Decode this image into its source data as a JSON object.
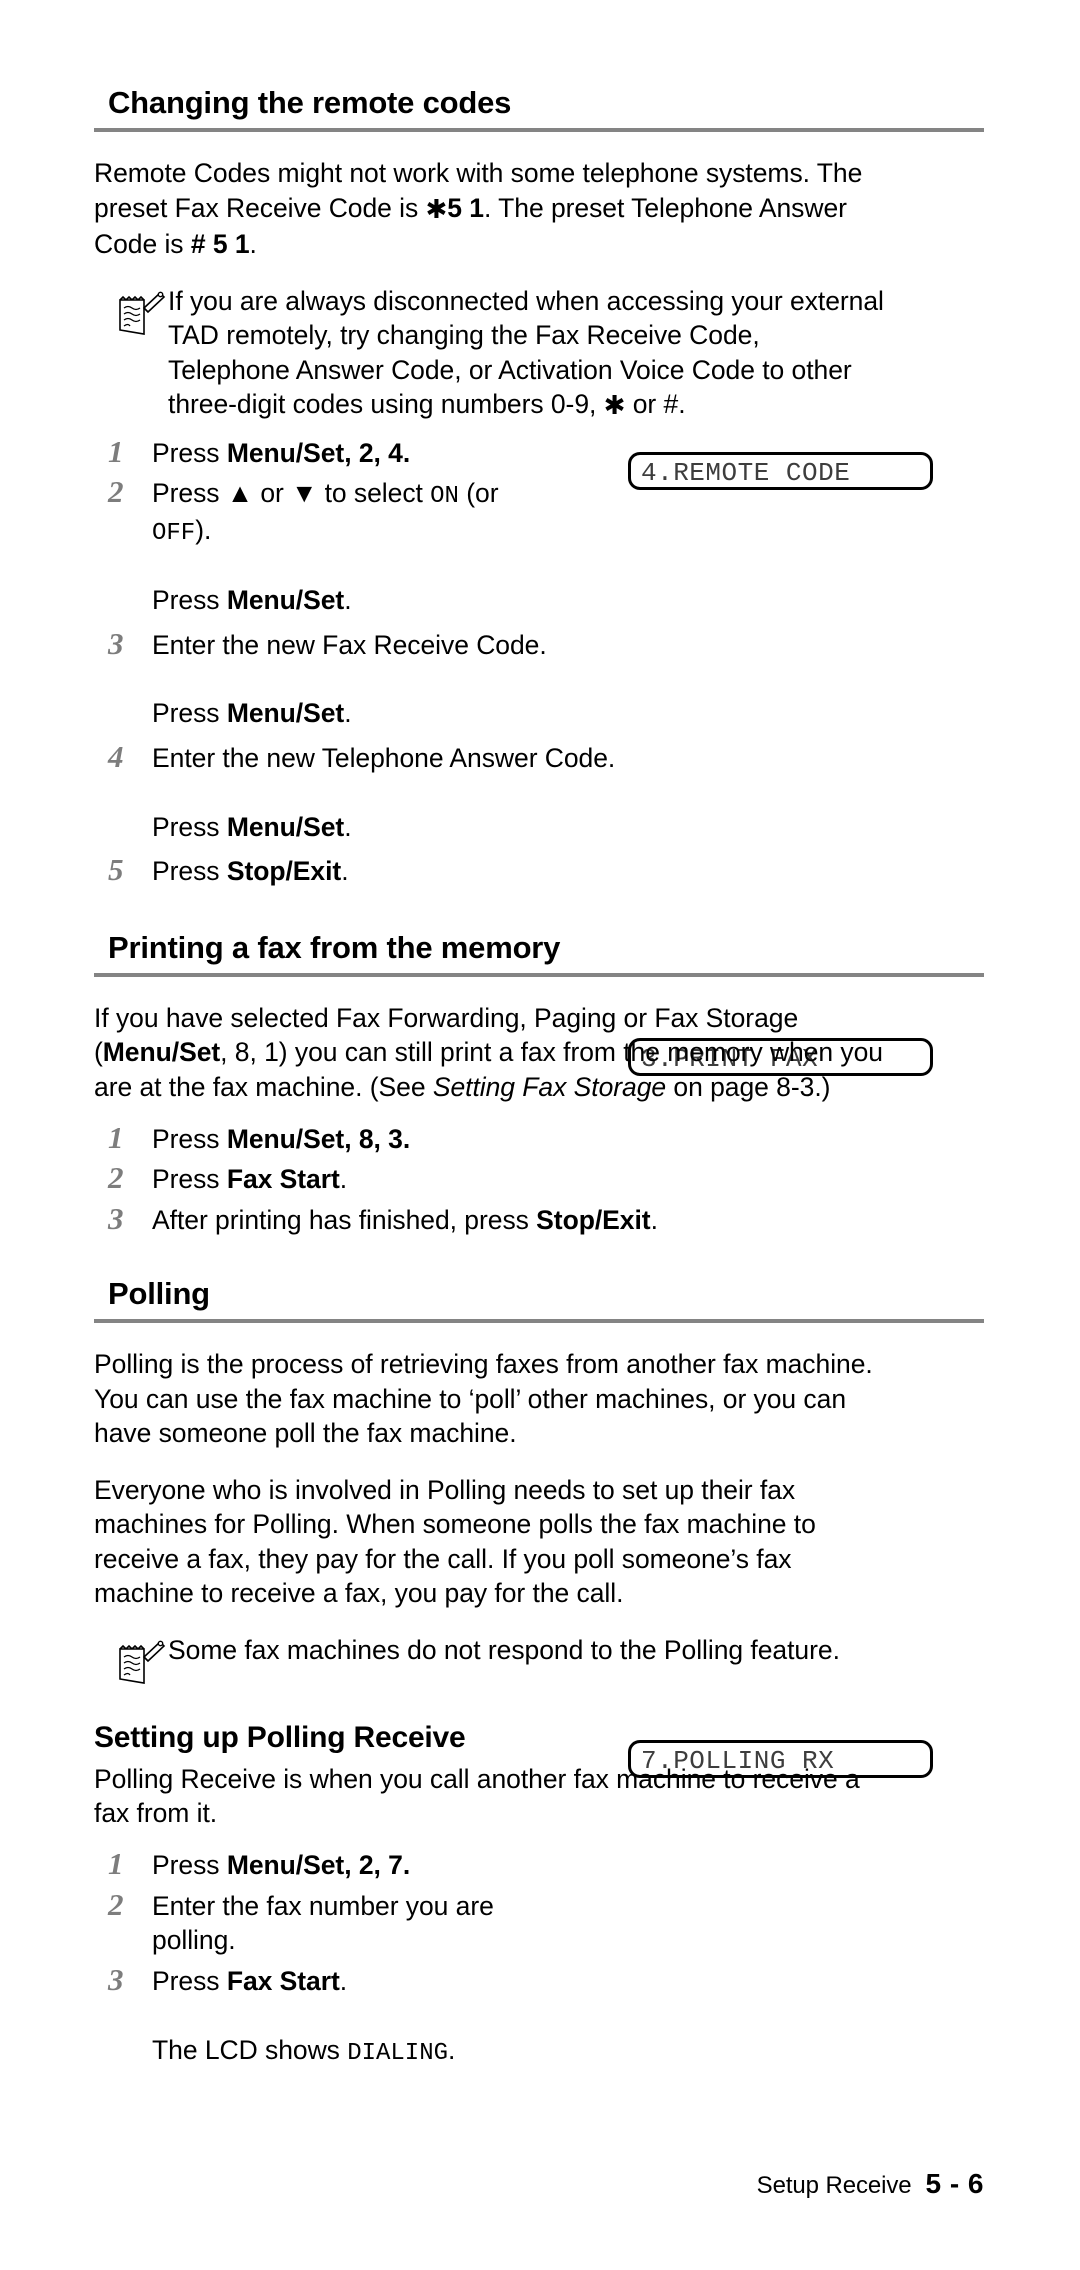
{
  "page": {
    "footer_label": "Setup Receive",
    "footer_page": "5 - 6"
  },
  "sections": {
    "remote_codes": {
      "heading": "Changing the remote codes",
      "intro_line1": "Remote Codes might not work with some telephone systems. The",
      "intro_line2_a": "preset Fax Receive Code is ",
      "intro_line2_ast": "✱",
      "intro_line2_code": "5 1",
      "intro_line2_b": ". The preset Telephone Answer",
      "intro_line3_a": "Code is ",
      "intro_line3_hash": "# 5 1",
      "intro_line3_b": ".",
      "note_line1": "If you are always disconnected when accessing your external",
      "note_line2": "TAD remotely, try changing the Fax Receive Code,",
      "note_line3": "Telephone Answer Code, or Activation Voice Code to other",
      "note_line4_a": "three-digit codes using numbers 0-9, ",
      "note_line4_ast": "✱",
      "note_line4_b": " or ",
      "note_line4_hash": "#",
      "note_line4_c": ".",
      "note_icon": "notepad-pencil-icon",
      "steps": [
        {
          "num": "1",
          "text_pre": "Press ",
          "text_bold": "Menu/Set",
          "text_post": ", 2, 4."
        },
        {
          "num": "2",
          "text_pre": "Press ",
          "up_arrow": "▲",
          "mid": " or ",
          "down_arrow": "▼",
          "mid2": " to select ",
          "mono_on": "ON",
          "mid3": " (or",
          "line2_mono_off": "OFF",
          "line2_post": ").",
          "line3_pre": "Press ",
          "line3_bold": "Menu/Set",
          "line3_post": "."
        },
        {
          "num": "3",
          "text": "Enter the new Fax Receive Code.",
          "line2_pre": "Press ",
          "line2_bold": "Menu/Set",
          "line2_post": "."
        },
        {
          "num": "4",
          "text": "Enter the new Telephone Answer Code.",
          "line2_pre": "Press ",
          "line2_bold": "Menu/Set",
          "line2_post": "."
        },
        {
          "num": "5",
          "text_pre": "Press ",
          "text_bold": "Stop/Exit",
          "text_post": "."
        }
      ],
      "lcd": "4.REMOTE CODE"
    },
    "print_fax": {
      "heading": "Printing a fax from the memory",
      "intro_line1": "If you have selected Fax Forwarding, Paging or Fax Storage",
      "intro_line2_open": "(",
      "intro_line2_bold": "Menu/Set",
      "intro_line2_rest": ", 8, 1) you can still print a fax from the memory when you",
      "intro_line3_a": "are at the fax machine. (See ",
      "intro_line3_italic": "Setting Fax Storage",
      "intro_line3_b": " on page 8-3.)",
      "steps": [
        {
          "num": "1",
          "text_pre": "Press ",
          "text_bold": "Menu/Set",
          "text_post": ", 8, 3."
        },
        {
          "num": "2",
          "text_pre": "Press ",
          "text_bold": "Fax Start",
          "text_post": "."
        },
        {
          "num": "3",
          "text_pre": "After printing has finished, press ",
          "text_bold": "Stop/Exit",
          "text_post": "."
        }
      ],
      "lcd": "3.PRINT FAX"
    },
    "polling": {
      "heading": "Polling",
      "para1_line1": "Polling is the process of retrieving faxes from another fax machine.",
      "para1_line2": "You can use the fax machine to ‘poll’ other machines, or you can",
      "para1_line3": "have someone poll the fax machine.",
      "para2_line1": "Everyone who is involved in Polling needs to set up their fax",
      "para2_line2": "machines for Polling. When someone polls the fax machine to",
      "para2_line3": "receive a fax, they pay for the call. If you poll someone’s fax",
      "para2_line4": "machine to receive a fax, you pay for the call.",
      "note_icon": "notepad-pencil-icon",
      "note_text": "Some fax machines do not respond to the Polling feature."
    },
    "polling_receive": {
      "heading": "Setting up Polling Receive",
      "intro_line1": "Polling Receive is when you call another fax machine to receive a",
      "intro_line2": "fax from it.",
      "steps": [
        {
          "num": "1",
          "text_pre": "Press ",
          "text_bold": "Menu/Set",
          "text_post": ", 2, 7."
        },
        {
          "num": "2",
          "line1": "Enter the fax number you are",
          "line2": "polling."
        },
        {
          "num": "3",
          "text_pre": "Press ",
          "text_bold": "Fax Start",
          "text_post": ".",
          "line2_pre": "The LCD shows ",
          "line2_mono": "DIALING",
          "line2_post": "."
        }
      ],
      "lcd": "7.POLLING RX"
    }
  },
  "colors": {
    "rule": "#848484",
    "step_number": "#7d7d7d",
    "lcd_text": "#3d3d3d"
  }
}
